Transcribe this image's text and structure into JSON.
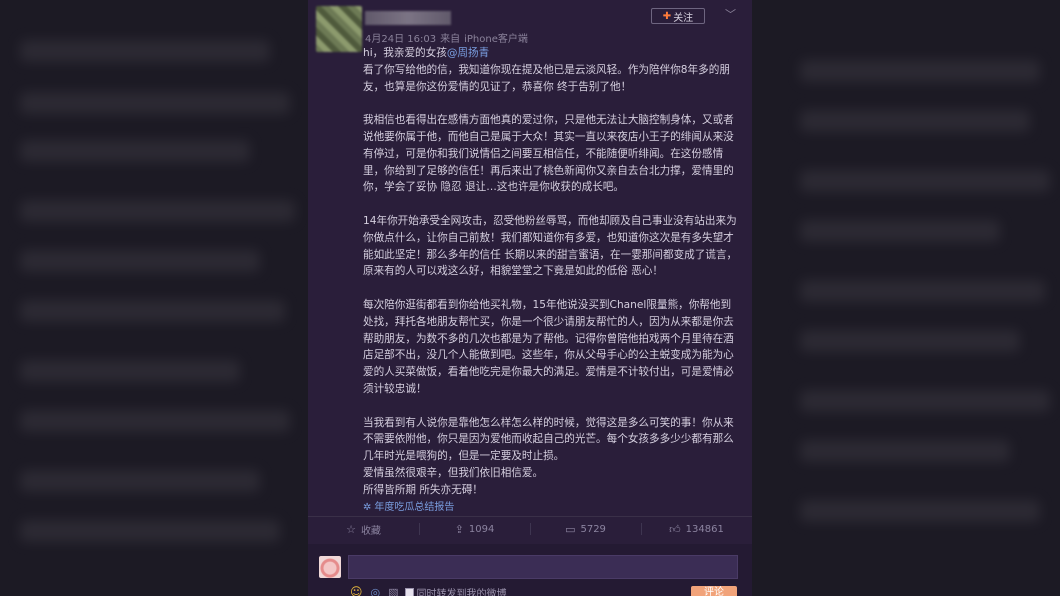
{
  "post": {
    "timestamp": "4月24日 16:03",
    "source_prefix": "来自",
    "source": "iPhone客户端",
    "follow_label": "关注",
    "collapse_icon": "chevron-down-icon",
    "greeting_prefix": "hi，我亲爱的女孩",
    "mention": "@周扬青",
    "paragraphs": [
      "看了你写给他的信，我知道你现在提及他已是云淡风轻。作为陪伴你8年多的朋友，也算是你这份爱情的见证了，恭喜你 终于告别了他！",
      "我相信也看得出在感情方面他真的爱过你，只是他无法让大脑控制身体，又或者说他要你属于他，而他自己是属于大众！其实一直以来夜店小王子的绯闻从来没有停过，可是你和我们说情侣之间要互相信任，不能随便听绯闻。在这份感情里，你给到了足够的信任！再后来出了桃色新闻你又亲自去台北力撑，爱情里的你，学会了妥协 隐忍 退让…这也许是你收获的成长吧。",
      "14年你开始承受全网攻击，忍受他粉丝辱骂，而他却顾及自己事业没有站出来为你做点什么，让你自己前敖！我们都知道你有多爱，也知道你这次是有多失望才能如此坚定！那么多年的信任 长期以来的甜言蜜语，在一霎那间都变成了谎言，原来有的人可以戏这么好，相貌堂堂之下竟是如此的低俗 恶心！",
      "每次陪你逛街都看到你给他买礼物，15年他说没买到Chanel限量熊，你帮他到处找，拜托各地朋友帮忙买，你是一个很少请朋友帮忙的人，因为从来都是你去帮助朋友，为数不多的几次也都是为了帮他。记得你曾陪他拍戏两个月里待在酒店足部不出，没几个人能做到吧。这些年，你从父母手心的公主蜕变成为能为心爱的人买菜做饭，看着他吃完是你最大的满足。爱情是不计较付出，可是爱情必须计较忠诚！",
      "当我看到有人说你是靠他怎么样怎么样的时候，觉得这是多么可笑的事！你从来不需要依附他，你只是因为爱他而收起自己的光芒。每个女孩多多少少都有那么几年时光是喂狗的，但是一定要及时止损。"
    ],
    "closing_lines": [
      "爱情虽然很艰辛，但我们依旧相信爱。",
      "所得皆所期 所失亦无碍！"
    ],
    "report_link": "年度吃瓜总结报告"
  },
  "actions": {
    "favorite_label": "收藏",
    "repost_count": "1094",
    "comment_count": "5729",
    "like_count": "134861"
  },
  "comment_box": {
    "sync_label": "同时转发到我的微博",
    "submit_label": "评论"
  }
}
